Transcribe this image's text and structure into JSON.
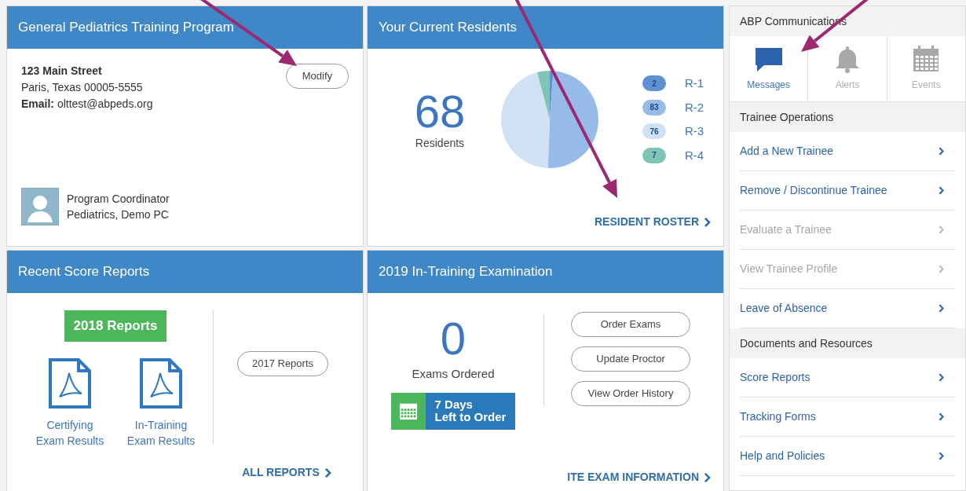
{
  "program_card": {
    "title": "General Pediatrics Training Program",
    "address_lines": [
      "123 Main Street",
      "Paris, Texas 00005-5555",
      "**Email:** olttest@abpeds.org"
    ],
    "modify_button": "Modify",
    "coordinator": {
      "role": "Program Coordinator",
      "name": "Pediatrics, Demo PC"
    }
  },
  "residents_card": {
    "title": "Your Current Residents",
    "total": "68",
    "total_label": "Residents",
    "chart_data": {
      "type": "pie",
      "categories": [
        "R-1",
        "R-2",
        "R-3",
        "R-4"
      ],
      "values": [
        2,
        83,
        76,
        7
      ],
      "colors": [
        "#5e90d2",
        "#97bbe8",
        "#cfe1f5",
        "#7fc5b5"
      ],
      "legend": "right",
      "value_labels": [
        "2",
        "83",
        "76",
        "7"
      ]
    },
    "link": "RESIDENT ROSTER"
  },
  "score_reports_card": {
    "title": "Recent Score Reports",
    "current_badge": "2018 Reports",
    "documents": [
      {
        "line1": "Certifying",
        "line2": "Exam Results"
      },
      {
        "line1": "In-Training",
        "line2": "Exam Results"
      }
    ],
    "previous_button": "2017 Reports",
    "link": "ALL REPORTS"
  },
  "ite_card": {
    "title": "2019 In-Training Examination",
    "count": "0",
    "count_label": "Exams Ordered",
    "deadline": {
      "line1": "7 Days",
      "line2": "Left to Order"
    },
    "buttons": [
      "Order Exams",
      "Update Proctor",
      "View Order History"
    ],
    "link": "ITE EXAM INFORMATION"
  },
  "sidebar": {
    "communications_title": "ABP Communications",
    "tabs": [
      {
        "label": "Messages",
        "kind": "message",
        "selected": true
      },
      {
        "label": "Alerts",
        "kind": "bell",
        "selected": false
      },
      {
        "label": "Events",
        "kind": "calendar",
        "selected": false
      }
    ],
    "items": [
      {
        "kind": "header",
        "label": "Trainee Operations"
      },
      {
        "kind": "link",
        "label": "Add a New Trainee",
        "disabled": false
      },
      {
        "kind": "link",
        "label": "Remove / Discontinue Trainee",
        "disabled": false
      },
      {
        "kind": "link",
        "label": "Evaluate a Trainee",
        "disabled": true
      },
      {
        "kind": "link",
        "label": "View Trainee Profile",
        "disabled": true
      },
      {
        "kind": "link",
        "label": "Leave of Absence",
        "disabled": false
      },
      {
        "kind": "header",
        "label": "Documents and Resources"
      },
      {
        "kind": "link",
        "label": "Score Reports",
        "disabled": false
      },
      {
        "kind": "link",
        "label": "Tracking Forms",
        "disabled": false
      },
      {
        "kind": "link",
        "label": "Help and Policies",
        "disabled": false
      }
    ]
  }
}
